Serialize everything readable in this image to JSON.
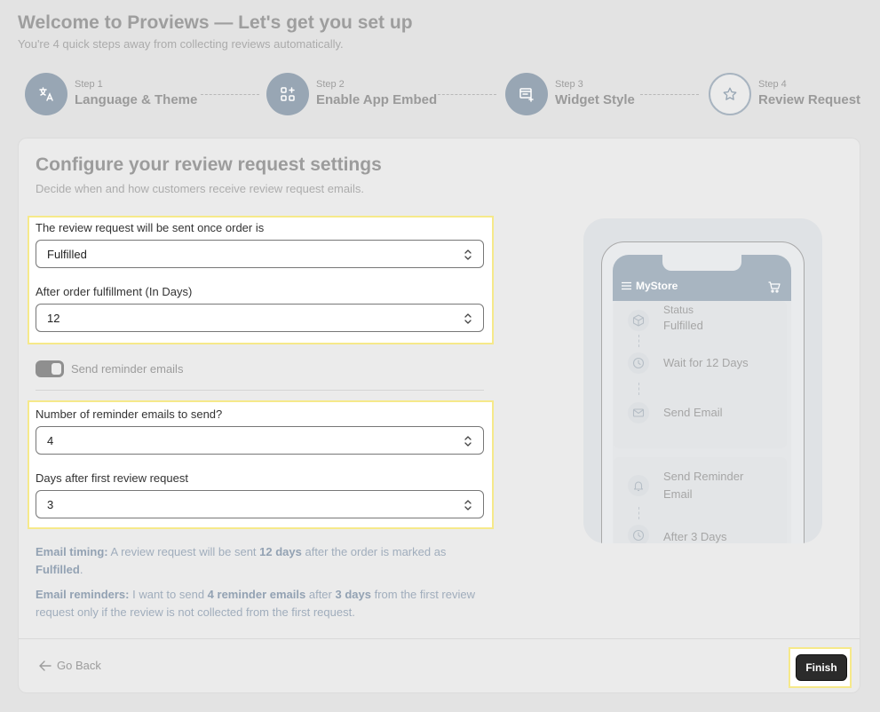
{
  "header": {
    "title": "Welcome to Proviews — Let's get you set up",
    "subtitle": "You're 4 quick steps away from collecting reviews automatically."
  },
  "steps": [
    {
      "num": "Step 1",
      "label": "Language & Theme",
      "icon": "translate-icon",
      "state": "complete"
    },
    {
      "num": "Step 2",
      "label": "Enable App Embed",
      "icon": "app-grid-icon",
      "state": "complete"
    },
    {
      "num": "Step 3",
      "label": "Widget Style",
      "icon": "widget-icon",
      "state": "complete"
    },
    {
      "num": "Step 4",
      "label": "Review Request",
      "icon": "star-icon",
      "state": "current"
    }
  ],
  "card": {
    "title": "Configure your review request settings",
    "subtitle": "Decide when and how customers receive review request emails."
  },
  "form": {
    "order_status_label": "The review request will be sent once order is",
    "order_status_value": "Fulfilled",
    "days_label": "After order fulfillment (In Days)",
    "days_value": "12",
    "reminder_toggle_label": "Send reminder emails",
    "reminder_count_label": "Number of reminder emails to send?",
    "reminder_count_value": "4",
    "reminder_days_label": "Days after first review request",
    "reminder_days_value": "3"
  },
  "info": {
    "timing_label": "Email timing:",
    "timing_t1": " A review request will be sent ",
    "timing_b1": "12 days",
    "timing_t2": " after the order is marked as ",
    "timing_b2": "Fulfilled",
    "timing_t3": ".",
    "reminders_label": "Email reminders:",
    "reminders_t1": " I want to send ",
    "reminders_b1": "4 reminder emails",
    "reminders_t2": " after ",
    "reminders_b2": "3 days",
    "reminders_t3": " from the first review request only if the review is not collected from the first request."
  },
  "preview": {
    "store_name": "MyStore",
    "status_label": "Status",
    "status_value": "Fulfilled",
    "wait_text": "Wait for 12 Days",
    "send_email": "Send Email",
    "send_reminder": "Send Reminder Email",
    "after_days": "After 3 Days"
  },
  "footer": {
    "go_back": "Go Back",
    "finish": "Finish"
  },
  "colors": {
    "step_complete": "#98a6b4",
    "finish_bg": "#2b2b2b",
    "highlight": "#f6e98a"
  }
}
